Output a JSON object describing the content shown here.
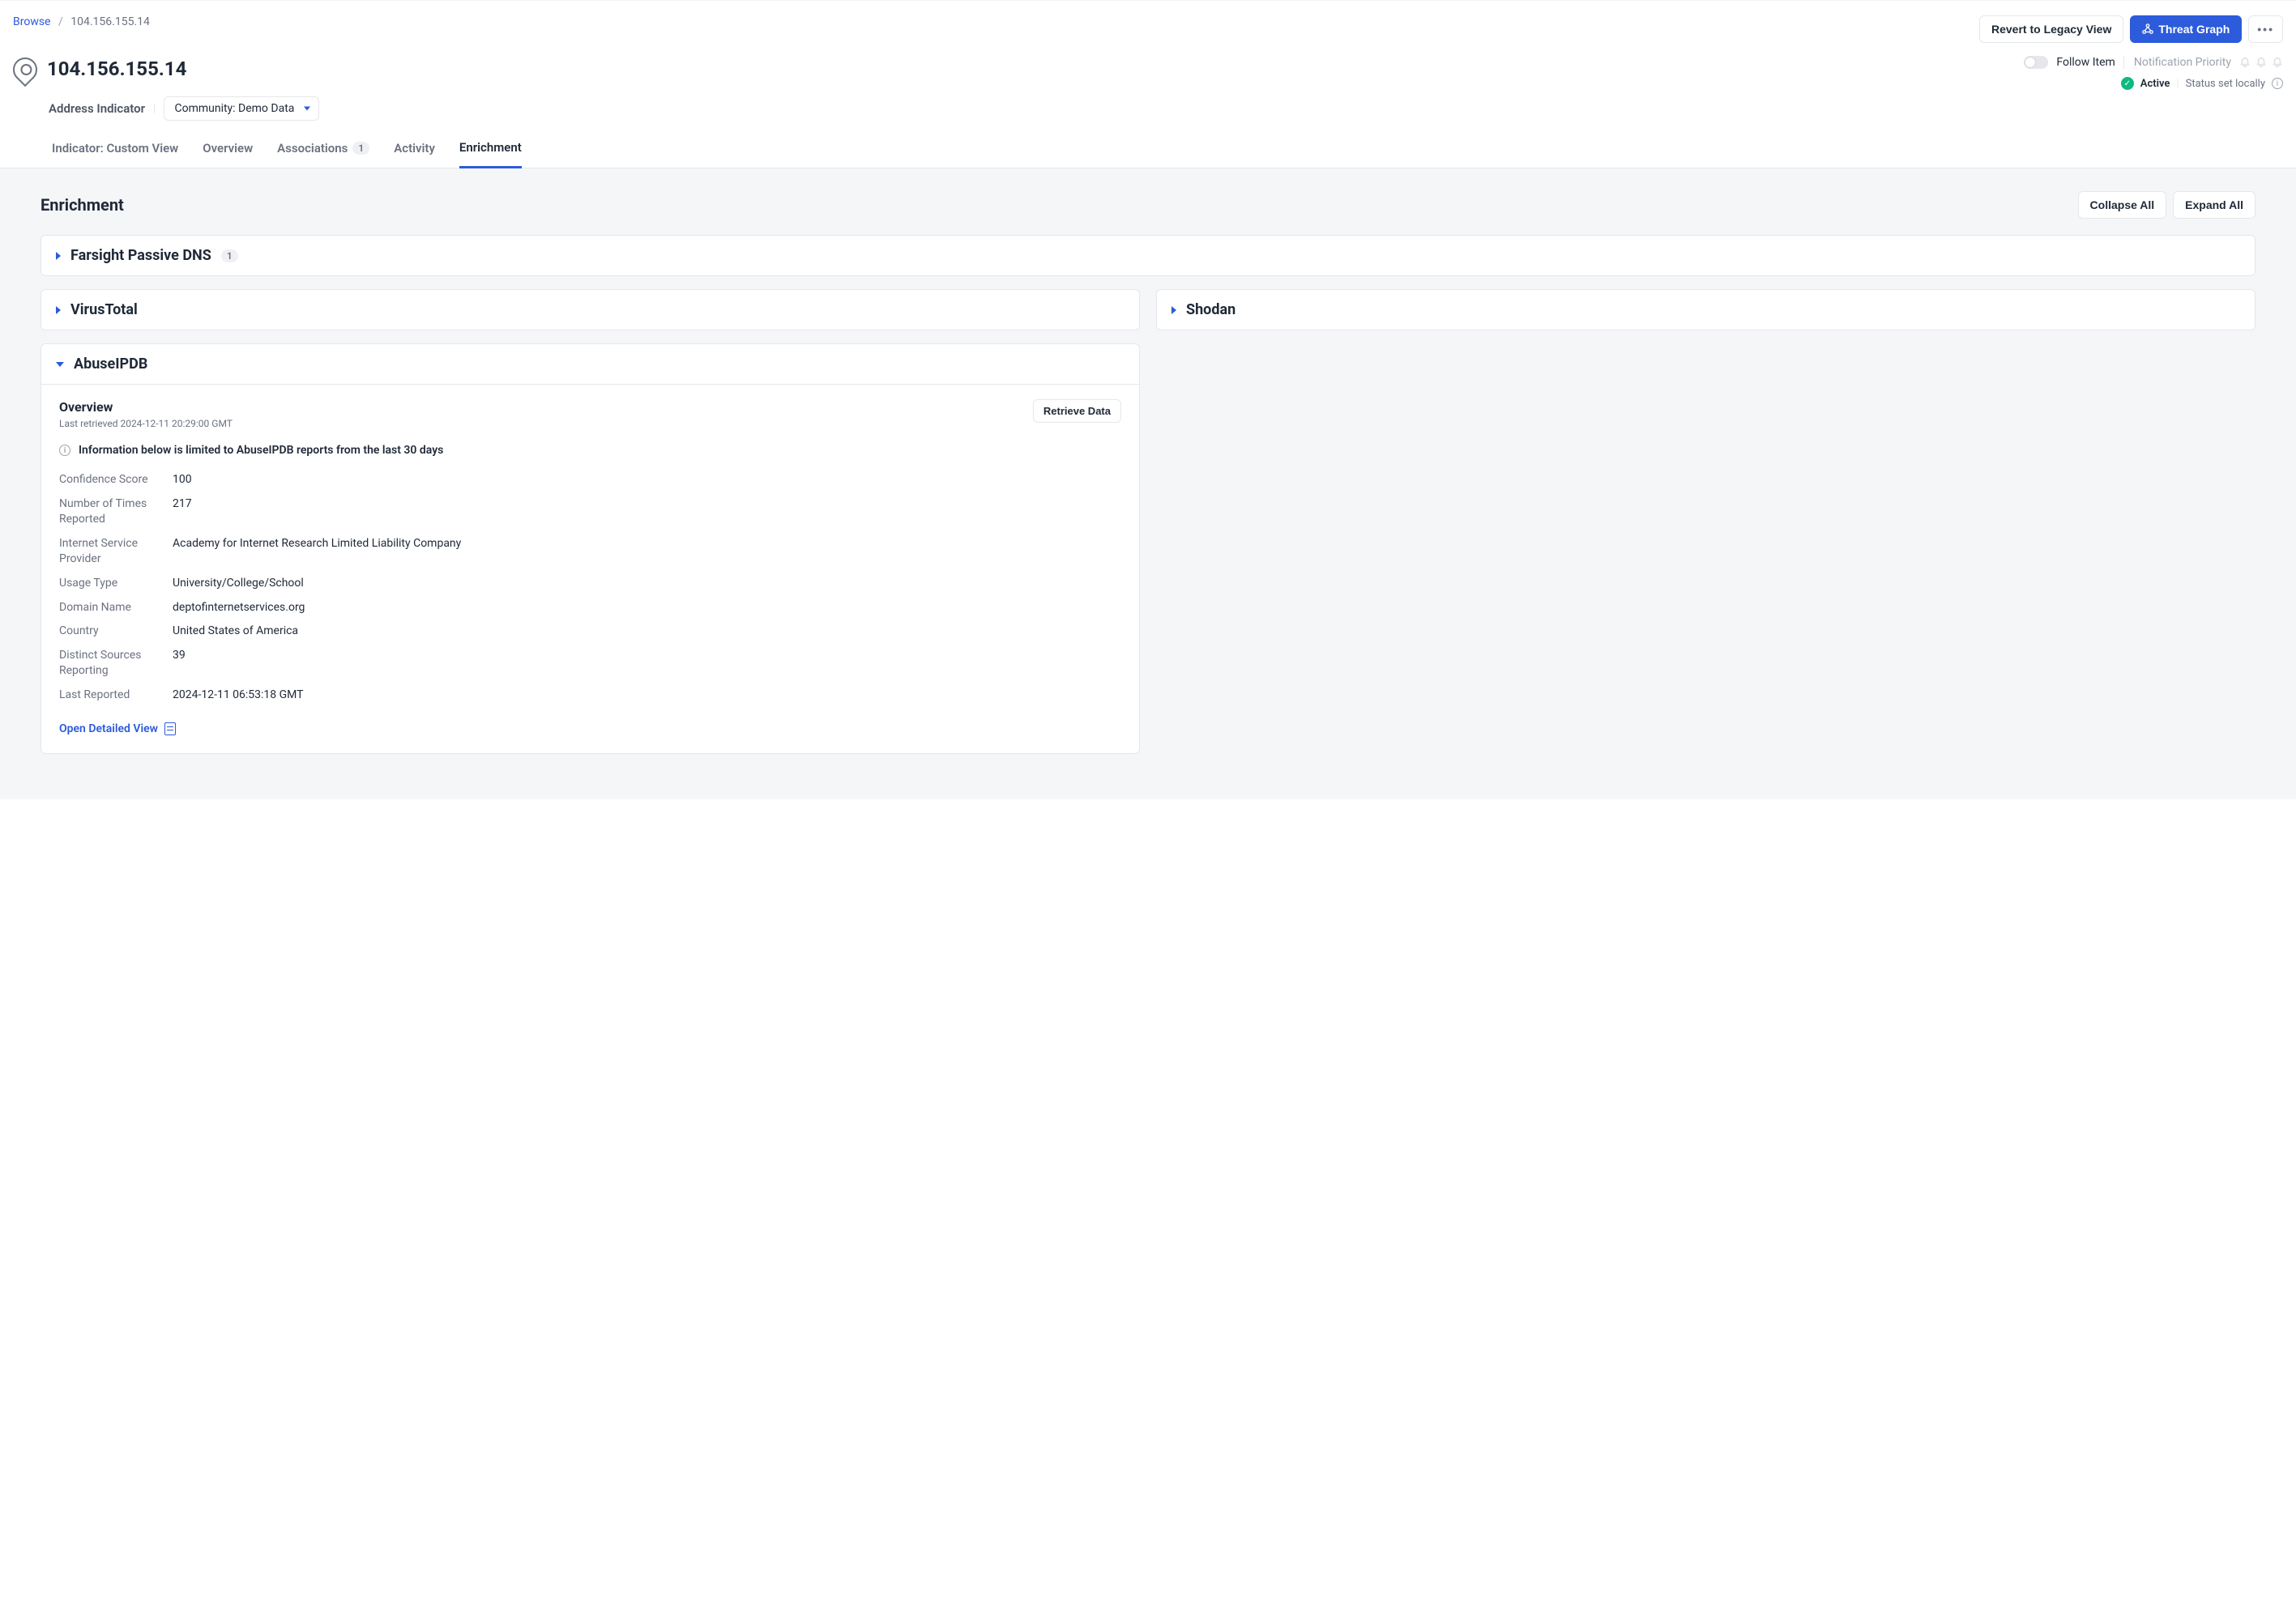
{
  "breadcrumb": {
    "root": "Browse",
    "current": "104.156.155.14"
  },
  "actions": {
    "revert": "Revert to Legacy View",
    "threat_graph": "Threat Graph"
  },
  "page": {
    "title": "104.156.155.14",
    "indicator_type": "Address Indicator",
    "community_label": "Community: Demo Data"
  },
  "follow": {
    "label": "Follow Item",
    "notification": "Notification Priority"
  },
  "status": {
    "label": "Active",
    "note": "Status set locally"
  },
  "tabs": {
    "custom": "Indicator: Custom View",
    "overview": "Overview",
    "associations": "Associations",
    "associations_count": "1",
    "activity": "Activity",
    "enrichment": "Enrichment"
  },
  "content": {
    "heading": "Enrichment",
    "collapse_all": "Collapse All",
    "expand_all": "Expand All"
  },
  "panels": {
    "farsight": {
      "title": "Farsight Passive DNS",
      "count": "1"
    },
    "virustotal": {
      "title": "VirusTotal"
    },
    "shodan": {
      "title": "Shodan"
    },
    "abuseipdb": {
      "title": "AbuseIPDB",
      "overview_label": "Overview",
      "retrieved_prefix": "Last retrieved ",
      "retrieved": "2024-12-11 20:29:00 GMT",
      "retrieve_button": "Retrieve Data",
      "notice": "Information below is limited to AbuseIPDB reports from the last 30 days",
      "fields": {
        "confidence_label": "Confidence Score",
        "confidence": "100",
        "reported_label": "Number of Times Reported",
        "reported": "217",
        "isp_label": "Internet Service Provider",
        "isp": "Academy for Internet Research Limited Liability Company",
        "usage_label": "Usage Type",
        "usage": "University/College/School",
        "domain_label": "Domain Name",
        "domain": "deptofinternetservices.org",
        "country_label": "Country",
        "country": "United States of America",
        "distinct_label": "Distinct Sources Reporting",
        "distinct": "39",
        "last_reported_label": "Last Reported",
        "last_reported": "2024-12-11 06:53:18 GMT"
      },
      "detail_link": "Open Detailed View"
    }
  }
}
